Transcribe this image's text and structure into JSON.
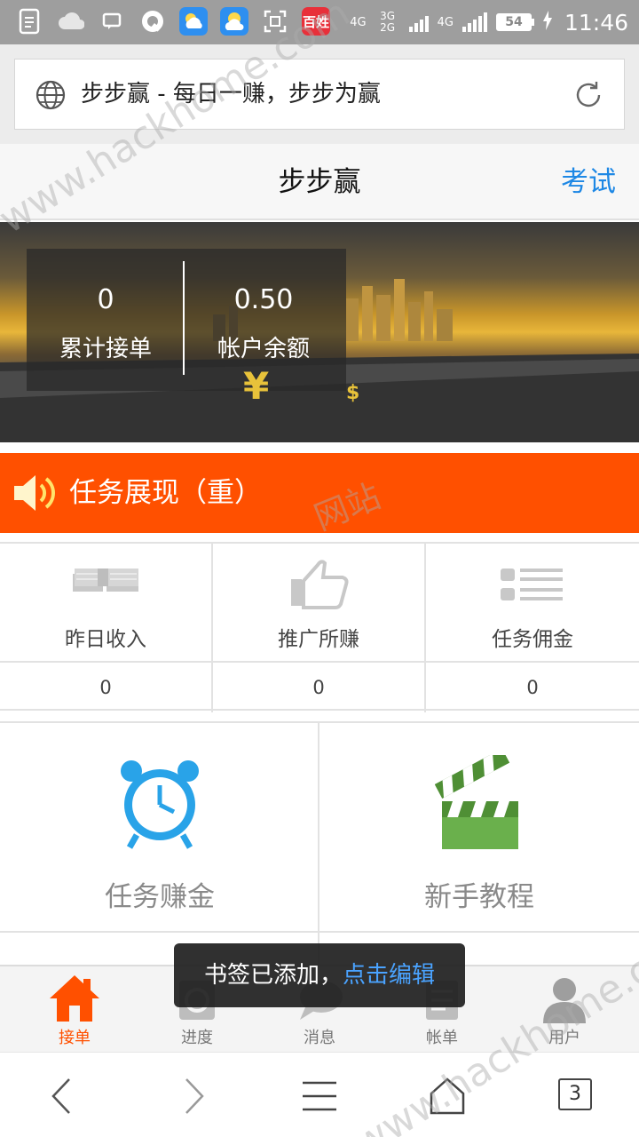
{
  "status_bar": {
    "network_label_1": "4G",
    "network_label_2": "3G 2G",
    "network_label_3": "4G",
    "battery": "54",
    "time": "11:46",
    "baixing_app_label": "百姓"
  },
  "address_bar": {
    "url_text": "步步赢 - 每日一赚，步步为赢"
  },
  "header": {
    "title": "步步赢",
    "exam_link": "考试"
  },
  "banner": {
    "total_orders_value": "0",
    "total_orders_label": "累计接单",
    "balance_value": "0.50",
    "balance_label": "帐户余额"
  },
  "notice": {
    "text": "任务展现（重）"
  },
  "stats": [
    {
      "label": "昨日收入",
      "value": "0",
      "icon": "money-stack-icon"
    },
    {
      "label": "推广所赚",
      "value": "0",
      "icon": "thumbs-up-icon"
    },
    {
      "label": "任务佣金",
      "value": "0",
      "icon": "list-icon"
    }
  ],
  "tiles": [
    {
      "label": "任务赚金",
      "icon": "alarm-clock-icon"
    },
    {
      "label": "新手教程",
      "icon": "clapperboard-icon"
    }
  ],
  "tabbar": [
    {
      "label": "接单",
      "icon": "home-icon",
      "active": true
    },
    {
      "label": "进度",
      "icon": "progress-icon",
      "active": false
    },
    {
      "label": "消息",
      "icon": "message-icon",
      "active": false
    },
    {
      "label": "帐单",
      "icon": "bill-icon",
      "active": false
    },
    {
      "label": "用户",
      "icon": "user-icon",
      "active": false
    }
  ],
  "toast": {
    "text": "书签已添加，",
    "link": "点击编辑"
  },
  "browser_nav": {
    "tab_count": "3"
  },
  "colors": {
    "accent_orange": "#ff5000",
    "link_blue": "#1e88e5",
    "clock_blue": "#29a3e8",
    "clapper_green": "#6ab04c"
  },
  "watermarks": {
    "top": "www.hackhome.com",
    "middle": "网站",
    "bottom": "www.hackhome.com"
  }
}
